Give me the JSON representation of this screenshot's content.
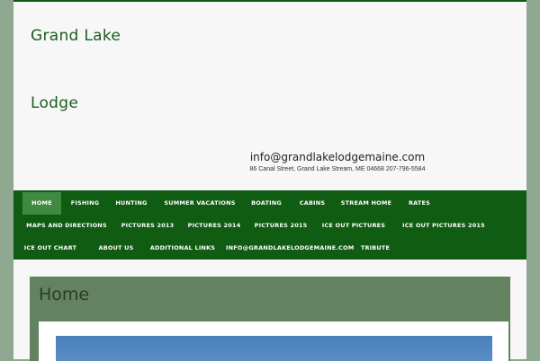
{
  "site": {
    "title_line1": "Grand Lake",
    "title_line2": "Lodge",
    "email": "info@grandlakelodgemaine.com",
    "address": "86 Canal Street, Grand Lake Stream, ME 04668 207-796-5584"
  },
  "nav": {
    "items": [
      "HOME",
      "FISHING",
      "HUNTING",
      "SUMMER VACATIONS",
      "BOATING",
      "CABINS",
      "STREAM HOME",
      "RATES",
      "MAPS AND DIRECTIONS",
      "PICTURES 2013",
      "PICTURES 2014",
      "PICTURES 2015",
      "ICE OUT PICTURES",
      "ICE OUT PICTURES 2015",
      "ICE OUT CHART",
      "ABOUT US",
      "ADDITIONAL LINKS",
      "INFO@GRANDLAKELODGEMAINE.COM",
      "TRIBUTE"
    ],
    "active": "HOME"
  },
  "content": {
    "heading": "Home"
  },
  "colors": {
    "brand_green": "#0f5c12",
    "active_tab": "#3f8a40",
    "content_header": "#63825f",
    "background": "#8fa890"
  }
}
